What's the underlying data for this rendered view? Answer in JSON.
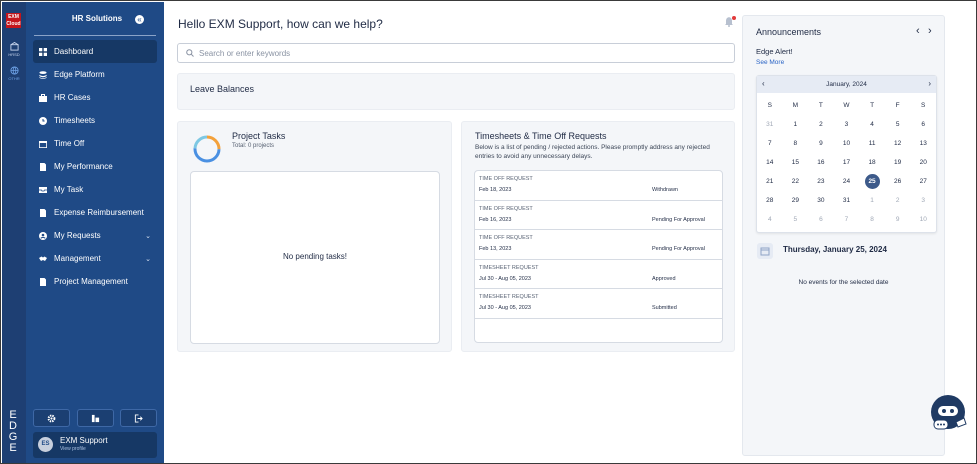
{
  "rail": {
    "logo_line1": "EXM",
    "logo_line2": "Cloud",
    "item1_label": "HRSD",
    "item2_label": "OTHR",
    "brand_letters": [
      "E",
      "D",
      "G",
      "E"
    ]
  },
  "sidebar": {
    "brand": "HR Solutions",
    "items": [
      {
        "label": "Dashboard",
        "icon": "grid-icon"
      },
      {
        "label": "Edge Platform",
        "icon": "layers-icon"
      },
      {
        "label": "HR Cases",
        "icon": "briefcase-icon"
      },
      {
        "label": "Timesheets",
        "icon": "clock-icon"
      },
      {
        "label": "Time Off",
        "icon": "calendar-icon"
      },
      {
        "label": "My Performance",
        "icon": "document-icon"
      },
      {
        "label": "My Task",
        "icon": "inbox-icon"
      },
      {
        "label": "Expense Reimbursement",
        "icon": "receipt-icon"
      },
      {
        "label": "My Requests",
        "icon": "user-icon"
      },
      {
        "label": "Management",
        "icon": "handshake-icon"
      },
      {
        "label": "Project Management",
        "icon": "file-icon"
      }
    ],
    "profile": {
      "initials": "ES",
      "name": "EXM Support",
      "link": "View profile"
    }
  },
  "header": {
    "greeting": "Hello EXM Support, how can we help?",
    "search_placeholder": "Search or enter keywords"
  },
  "leave": {
    "title": "Leave Balances"
  },
  "projects": {
    "title": "Project Tasks",
    "subtitle": "Total: 0 projects",
    "empty": "No pending tasks!"
  },
  "timesheets": {
    "title": "Timesheets & Time Off Requests",
    "description": "Below is a list of pending / rejected actions. Please promptly address any rejected entries to avoid any unnecessary delays.",
    "rows": [
      {
        "type": "TIME OFF REQUEST",
        "date": "Feb 18, 2023",
        "status": "Withdrawn"
      },
      {
        "type": "TIME OFF REQUEST",
        "date": "Feb 16, 2023",
        "status": "Pending For Approval"
      },
      {
        "type": "TIME OFF REQUEST",
        "date": "Feb 13, 2023",
        "status": "Pending For Approval"
      },
      {
        "type": "TIMESHEET REQUEST",
        "date": "Jul 30 - Aug 05, 2023",
        "status": "Approved"
      },
      {
        "type": "TIMESHEET REQUEST",
        "date": "Jul 30 - Aug 05, 2023",
        "status": "Submitted"
      }
    ]
  },
  "announcements": {
    "title": "Announcements",
    "alert": "Edge Alert!",
    "see_more": "See More"
  },
  "calendar": {
    "month": "January, 2024",
    "dow": [
      "S",
      "M",
      "T",
      "W",
      "T",
      "F",
      "S"
    ],
    "days": [
      {
        "d": "31",
        "m": true
      },
      {
        "d": "1"
      },
      {
        "d": "2"
      },
      {
        "d": "3"
      },
      {
        "d": "4"
      },
      {
        "d": "5"
      },
      {
        "d": "6"
      },
      {
        "d": "7"
      },
      {
        "d": "8"
      },
      {
        "d": "9"
      },
      {
        "d": "10"
      },
      {
        "d": "11"
      },
      {
        "d": "12"
      },
      {
        "d": "13"
      },
      {
        "d": "14"
      },
      {
        "d": "15"
      },
      {
        "d": "16"
      },
      {
        "d": "17"
      },
      {
        "d": "18"
      },
      {
        "d": "19"
      },
      {
        "d": "20"
      },
      {
        "d": "21"
      },
      {
        "d": "22"
      },
      {
        "d": "23"
      },
      {
        "d": "24"
      },
      {
        "d": "25",
        "s": true
      },
      {
        "d": "26"
      },
      {
        "d": "27"
      },
      {
        "d": "28"
      },
      {
        "d": "29"
      },
      {
        "d": "30"
      },
      {
        "d": "31"
      },
      {
        "d": "1",
        "m": true
      },
      {
        "d": "2",
        "m": true
      },
      {
        "d": "3",
        "m": true
      },
      {
        "d": "4",
        "m": true
      },
      {
        "d": "5",
        "m": true
      },
      {
        "d": "6",
        "m": true
      },
      {
        "d": "7",
        "m": true
      },
      {
        "d": "8",
        "m": true
      },
      {
        "d": "9",
        "m": true
      },
      {
        "d": "10",
        "m": true
      }
    ],
    "selected_date": "Thursday, January 25, 2024",
    "no_events": "No events for the selected date"
  },
  "colors": {
    "sidebar": "#1f4a86",
    "rail": "#1e3f73",
    "active": "#163865",
    "selected_day": "#3d5a8a",
    "notification_dot": "#e23b3b"
  }
}
